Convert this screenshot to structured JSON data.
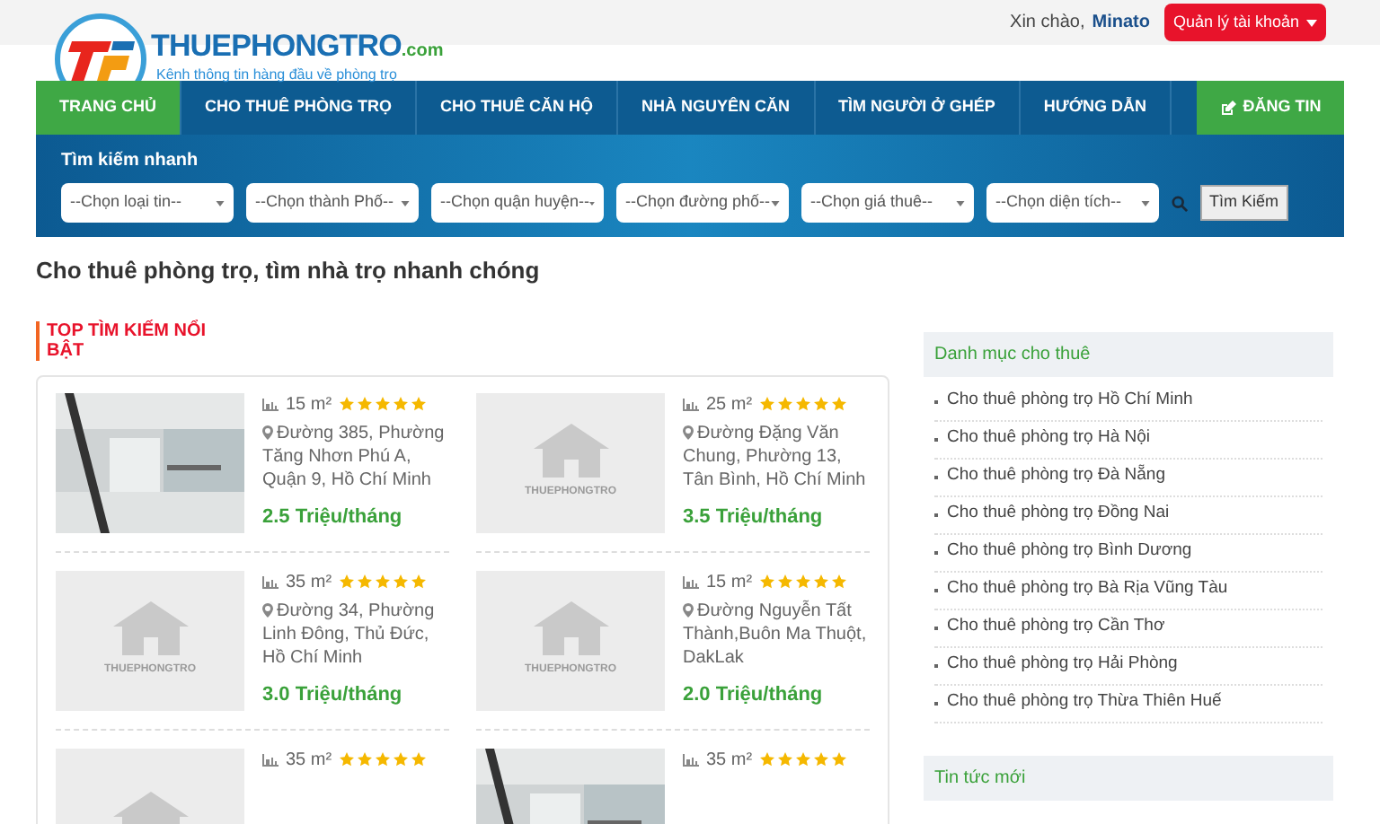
{
  "topbar": {
    "greeting": "Xin chào,",
    "user": "Minato",
    "account_button": "Quản lý tài khoản"
  },
  "logo": {
    "name": "THUEPHONGTRO",
    "suffix": ".com",
    "tagline": "Kênh thông tin hàng đầu về phòng trọ"
  },
  "nav": {
    "items": [
      {
        "label": "TRANG CHỦ",
        "selected": true
      },
      {
        "label": "CHO THUÊ PHÒNG TRỌ",
        "selected": false
      },
      {
        "label": "CHO THUÊ CĂN HỘ",
        "selected": false
      },
      {
        "label": "NHÀ NGUYÊN CĂN",
        "selected": false
      },
      {
        "label": "TÌM NGƯỜI Ở GHÉP",
        "selected": false
      },
      {
        "label": "HƯỚNG DẪN",
        "selected": false
      }
    ],
    "post_button": "ĐĂNG TIN"
  },
  "search": {
    "title": "Tìm kiếm nhanh",
    "selects": [
      "--Chọn loại tin--",
      "--Chọn thành Phố--",
      "--Chọn quận huyện--",
      "--Chọn đường phố--",
      "--Chọn giá thuê--",
      "--Chọn diện tích--"
    ],
    "button": "Tìm Kiếm"
  },
  "heading": "Cho thuê phòng trọ, tìm nhà trọ nhanh chóng",
  "top_section": {
    "title": "TOP TÌM KIẾM NỔI BẬT",
    "listings": [
      {
        "area": "15 m²",
        "stars": 5,
        "address": "Đường 385, Phường Tăng Nhơn Phú A, Quận 9, Hồ Chí Minh",
        "price": "2.5 Triệu/tháng"
      },
      {
        "kind": "placeholder",
        "caption": "THUEPHONGTRO",
        "area": "25 m²",
        "stars": 5,
        "address": "Đường Đặng Văn Chung, Phường 13, Tân Bình, Hồ Chí Minh",
        "price": "3.5 Triệu/tháng"
      },
      {
        "kind": "placeholder",
        "caption": "THUEPHONGTRO",
        "area": "35 m²",
        "stars": 5,
        "address": "Đường 34, Phường Linh Đông, Thủ Đức, Hồ Chí Minh",
        "price": "3.0 Triệu/tháng"
      },
      {
        "kind": "placeholder",
        "caption": "THUEPHONGTRO",
        "area": "15 m²",
        "stars": 5,
        "address": "Đường Nguyễn Tất Thành,Buôn Ma Thuột, DakLak",
        "price": "2.0 Triệu/tháng"
      },
      {
        "kind": "placeholder",
        "area": "35 m²",
        "stars": 5
      },
      {
        "area": "35 m²",
        "stars": 5
      }
    ]
  },
  "categories": {
    "title": "Danh mục cho thuê",
    "items": [
      "Cho thuê phòng trọ Hồ Chí Minh",
      "Cho thuê phòng trọ Hà Nội",
      "Cho thuê phòng trọ Đà Nẵng",
      "Cho thuê phòng trọ Đồng Nai",
      "Cho thuê phòng trọ Bình Dương",
      "Cho thuê phòng trọ Bà Rịa Vũng Tàu",
      "Cho thuê phòng trọ Cần Thơ",
      "Cho thuê phòng trọ Hải Phòng",
      "Cho thuê phòng trọ Thừa Thiên Huế"
    ]
  },
  "news": {
    "title": "Tin tức mới"
  }
}
